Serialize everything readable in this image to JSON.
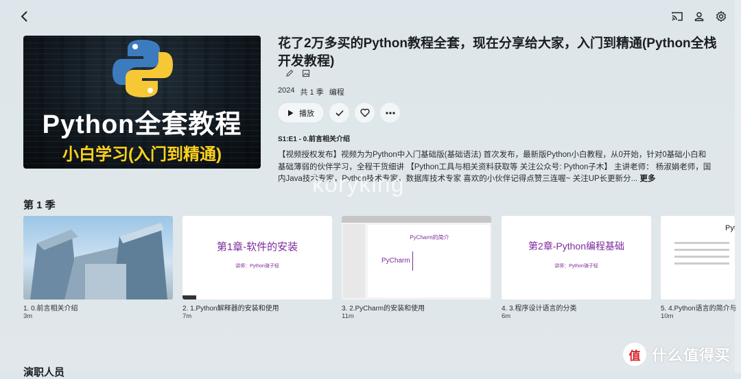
{
  "header": {
    "back": "back-icon",
    "cast": "cast-icon",
    "user": "user-icon",
    "settings": "gear-icon"
  },
  "poster": {
    "title": "Python全套教程",
    "subtitle": "小白学习(入门到精通)"
  },
  "item": {
    "title": "花了2万多买的Python教程全套，现在分享给大家，入门到精通(Python全栈开发教程)",
    "year": "2024",
    "seasons": "共 1 季",
    "genre": "编程",
    "play_label": "播放",
    "next_episode": "S1:E1 - 0.前言相关介绍",
    "description": "【视频授权发布】视频为为Python中入门基础版(基础语法) 首次发布，最新版Python小白教程，从0开始，针对0基础小白和基础薄弱的伙伴学习，全程干货细讲 【Python工具与相关资料获取等 关注公众号: Python子木】 主讲老师： 杨淑娟老师，国内Java技术专家，Python技术专家，数据库技术专家 喜欢的小伙伴记得点赞三连喔~ 关注UP长更新分...",
    "more": "更多"
  },
  "watermark": "koryking",
  "season_title": "第 1 季",
  "episodes": [
    {
      "title": "1. 0.前言相关介绍",
      "duration": "3m",
      "thumb_heading": ""
    },
    {
      "title": "2. 1.Python解释器的安装和使用",
      "duration": "7m",
      "thumb_heading": "第1章-软件的安装",
      "thumb_sub": "讲师：Python骑子轻"
    },
    {
      "title": "3. 2.PyCharm的安装和使用",
      "duration": "11m",
      "thumb_heading": "PyCharm的简介",
      "thumb_sub": "PyCharm"
    },
    {
      "title": "4. 3.程序设计语言的分类",
      "duration": "6m",
      "thumb_heading": "第2章-Python编程基础",
      "thumb_sub": "讲师：Python骑子轻"
    },
    {
      "title": "5. 4.Python语言的简介与",
      "duration": "10m",
      "thumb_heading": "Pyt",
      "thumb_sub": ""
    }
  ],
  "cast_title": "演职人员",
  "brand": {
    "text": "什么值得买",
    "mark": "值"
  },
  "colors": {
    "accent_yellow": "#ffd21c",
    "slide_purple": "#7b2a9c"
  }
}
